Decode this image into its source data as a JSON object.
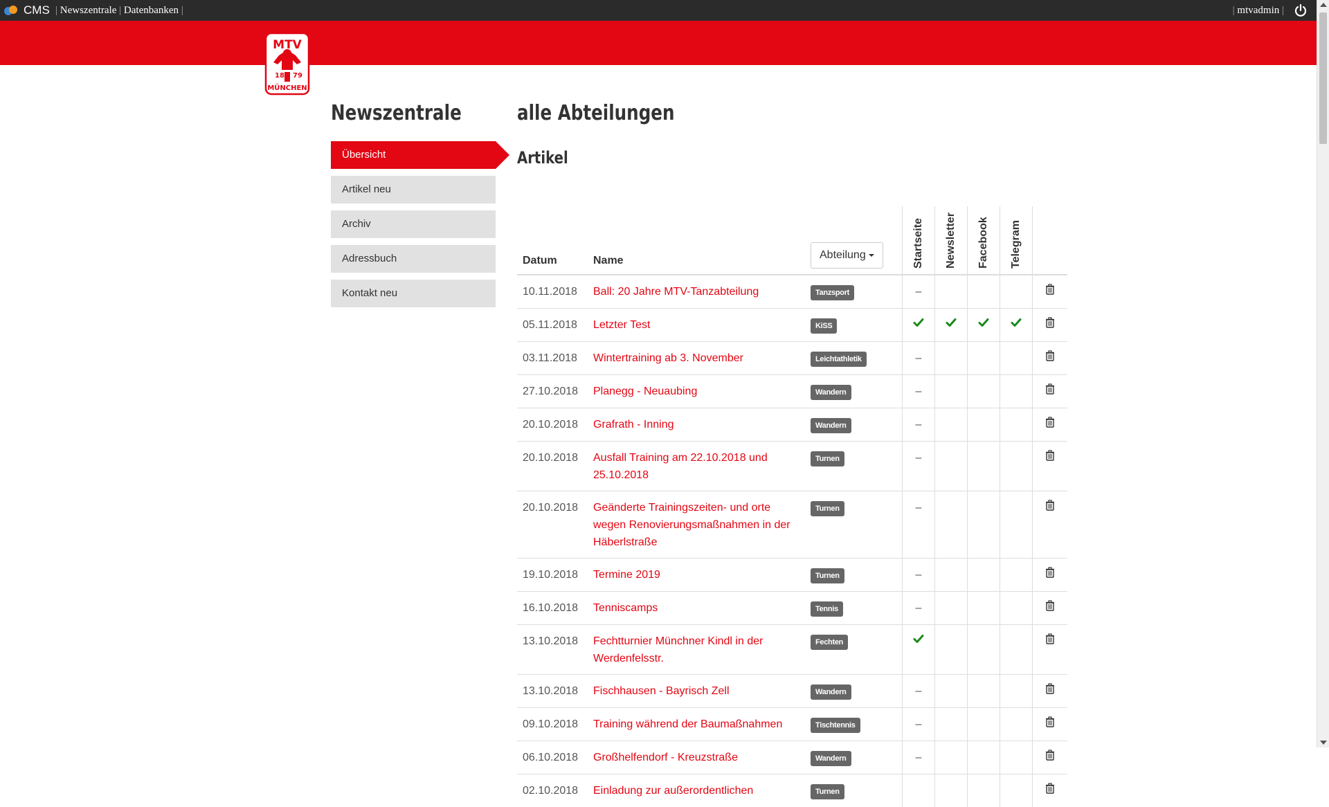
{
  "topbar": {
    "app_name": "CMS",
    "nav": [
      "Newszentrale",
      "Datenbanken"
    ],
    "user": "mtvadmin"
  },
  "logo": {
    "text_top": "MTV",
    "year_left": "18",
    "year_right": "79",
    "text_bottom": "MÜNCHEN"
  },
  "sidebar": {
    "title": "Newszentrale",
    "items": [
      {
        "label": "Übersicht",
        "active": true
      },
      {
        "label": "Artikel neu"
      },
      {
        "label": "Archiv"
      },
      {
        "label": "Adressbuch"
      },
      {
        "label": "Kontakt neu"
      }
    ]
  },
  "main": {
    "title": "alle Abteilungen",
    "subtitle": "Artikel",
    "table": {
      "headers": {
        "date": "Datum",
        "name": "Name",
        "dept_dropdown": "Abteilung",
        "flags": [
          "Startseite",
          "Newsletter",
          "Facebook",
          "Telegram"
        ]
      },
      "rows": [
        {
          "date": "10.11.2018",
          "name": "Ball: 20 Jahre MTV-Tanzabteilung",
          "dept": "Tanzsport",
          "startseite": "–",
          "newsletter": "",
          "facebook": "",
          "telegram": ""
        },
        {
          "date": "05.11.2018",
          "name": "Letzter Test",
          "dept": "KiSS",
          "startseite": "check",
          "newsletter": "check",
          "facebook": "check",
          "telegram": "check"
        },
        {
          "date": "03.11.2018",
          "name": "Wintertraining ab 3. November",
          "dept": "Leichtathletik",
          "startseite": "–",
          "newsletter": "",
          "facebook": "",
          "telegram": ""
        },
        {
          "date": "27.10.2018",
          "name": "Planegg - Neuaubing",
          "dept": "Wandern",
          "startseite": "–",
          "newsletter": "",
          "facebook": "",
          "telegram": ""
        },
        {
          "date": "20.10.2018",
          "name": "Grafrath - Inning",
          "dept": "Wandern",
          "startseite": "–",
          "newsletter": "",
          "facebook": "",
          "telegram": ""
        },
        {
          "date": "20.10.2018",
          "name": "Ausfall Training am 22.10.2018 und 25.10.2018",
          "dept": "Turnen",
          "startseite": "–",
          "newsletter": "",
          "facebook": "",
          "telegram": ""
        },
        {
          "date": "20.10.2018",
          "name": "Geänderte Trainingszeiten- und orte wegen Renovierungsmaßnahmen in der Häberlstraße",
          "dept": "Turnen",
          "startseite": "–",
          "newsletter": "",
          "facebook": "",
          "telegram": ""
        },
        {
          "date": "19.10.2018",
          "name": "Termine 2019",
          "dept": "Turnen",
          "startseite": "–",
          "newsletter": "",
          "facebook": "",
          "telegram": ""
        },
        {
          "date": "16.10.2018",
          "name": "Tenniscamps",
          "dept": "Tennis",
          "startseite": "–",
          "newsletter": "",
          "facebook": "",
          "telegram": ""
        },
        {
          "date": "13.10.2018",
          "name": "Fechtturnier Münchner Kindl in der Werdenfelsstr.",
          "dept": "Fechten",
          "startseite": "check",
          "newsletter": "",
          "facebook": "",
          "telegram": ""
        },
        {
          "date": "13.10.2018",
          "name": "Fischhausen - Bayrisch Zell",
          "dept": "Wandern",
          "startseite": "–",
          "newsletter": "",
          "facebook": "",
          "telegram": ""
        },
        {
          "date": "09.10.2018",
          "name": "Training während der Baumaßnahmen",
          "dept": "Tischtennis",
          "startseite": "–",
          "newsletter": "",
          "facebook": "",
          "telegram": ""
        },
        {
          "date": "06.10.2018",
          "name": "Großhelfendorf - Kreuzstraße",
          "dept": "Wandern",
          "startseite": "–",
          "newsletter": "",
          "facebook": "",
          "telegram": ""
        },
        {
          "date": "02.10.2018",
          "name": "Einladung zur außerordentlichen",
          "dept": "Turnen",
          "startseite": "",
          "newsletter": "",
          "facebook": "",
          "telegram": ""
        }
      ]
    }
  },
  "colors": {
    "brand_red": "#e30613",
    "check_green": "#1a8a1a",
    "badge_gray": "#666666"
  },
  "icons": [
    "cms-logo-icon",
    "power-icon",
    "check-icon",
    "trash-icon",
    "caret-down-icon"
  ]
}
